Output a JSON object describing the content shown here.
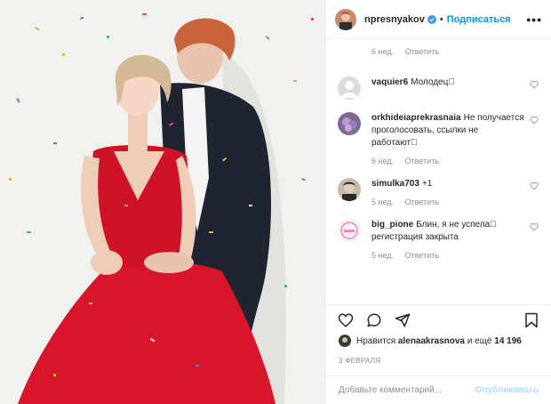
{
  "post": {
    "username": "npresnyakov",
    "separator": "•",
    "follow_label": "Подписаться",
    "more_icon": "more-horizontal-icon",
    "verified_color": "#3897f0",
    "accent": "#0095f6"
  },
  "first_meta": {
    "age": "6 нед.",
    "reply": "Ответить"
  },
  "comments": [
    {
      "username": "vaquier6",
      "text": "Молодец\u0000",
      "age": "",
      "reply": ""
    },
    {
      "username": "orkhideiaprekrasnaia",
      "text": "Не получается проголосовать, ссылки не работают\u0000",
      "age": "6 нед.",
      "reply": "Ответить"
    },
    {
      "username": "simulka703",
      "text": "+1",
      "age": "5 нед.",
      "reply": "Ответить"
    },
    {
      "username": "big_pione",
      "text": "Блин, я не успела\u0000 регистрация закрыта",
      "age": "5 нед.",
      "reply": "Ответить"
    }
  ],
  "likes": {
    "prefix": "Нравится",
    "user": "alenaakrasnova",
    "middle": "и ещё",
    "count": "14 196"
  },
  "date": "3 ФЕВРАЛЯ",
  "composer": {
    "placeholder": "Добавьте комментарий...",
    "publish": "Опубликовать"
  }
}
